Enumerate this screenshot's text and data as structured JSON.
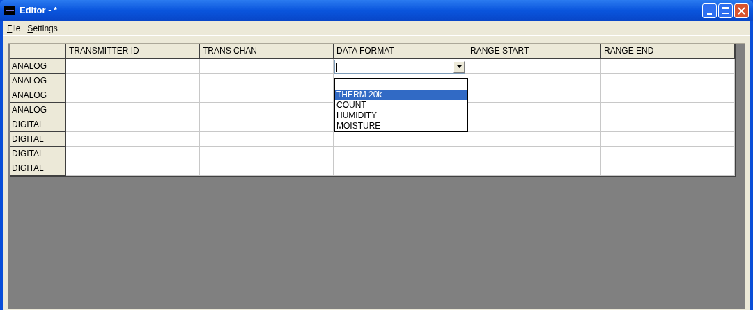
{
  "window": {
    "title": "Editor - *"
  },
  "menu": [
    "File",
    "Settings"
  ],
  "table": {
    "columns": [
      "TRANSMITTER ID",
      "TRANS CHAN",
      "DATA FORMAT",
      "RANGE START",
      "RANGE END"
    ],
    "rows": [
      {
        "label": "ANALOG",
        "cells": [
          {
            "kind": "empty"
          },
          {
            "kind": "empty"
          },
          {
            "kind": "combo"
          },
          {
            "kind": "empty"
          },
          {
            "kind": "empty"
          }
        ]
      },
      {
        "label": "ANALOG",
        "cells": [
          {
            "kind": "empty"
          },
          {
            "kind": "empty"
          },
          {
            "kind": "empty"
          },
          {
            "kind": "empty"
          },
          {
            "kind": "empty"
          }
        ]
      },
      {
        "label": "ANALOG",
        "cells": [
          {
            "kind": "empty"
          },
          {
            "kind": "empty"
          },
          {
            "kind": "empty"
          },
          {
            "kind": "empty"
          },
          {
            "kind": "empty"
          }
        ]
      },
      {
        "label": "ANALOG",
        "cells": [
          {
            "kind": "empty"
          },
          {
            "kind": "empty"
          },
          {
            "kind": "empty"
          },
          {
            "kind": "empty"
          },
          {
            "kind": "empty"
          }
        ]
      },
      {
        "label": "DIGITAL",
        "cells": [
          {
            "kind": "empty"
          },
          {
            "kind": "empty"
          },
          {
            "kind": "empty"
          },
          {
            "kind": "empty"
          },
          {
            "kind": "empty"
          }
        ]
      },
      {
        "label": "DIGITAL",
        "cells": [
          {
            "kind": "empty"
          },
          {
            "kind": "empty"
          },
          {
            "kind": "empty"
          },
          {
            "kind": "empty"
          },
          {
            "kind": "empty"
          }
        ]
      },
      {
        "label": "DIGITAL",
        "cells": [
          {
            "kind": "empty"
          },
          {
            "kind": "empty"
          },
          {
            "kind": "empty"
          },
          {
            "kind": "empty"
          },
          {
            "kind": "empty"
          }
        ]
      },
      {
        "label": "DIGITAL",
        "cells": [
          {
            "kind": "empty"
          },
          {
            "kind": "empty"
          },
          {
            "kind": "empty"
          },
          {
            "kind": "empty"
          },
          {
            "kind": "empty"
          }
        ]
      }
    ]
  },
  "dropdown": {
    "expanded": true,
    "options": [
      {
        "label": "THERM 20k",
        "selected": true
      },
      {
        "label": "COUNT",
        "selected": false
      },
      {
        "label": "HUMIDITY",
        "selected": false
      },
      {
        "label": "MOISTURE",
        "selected": false
      }
    ]
  }
}
